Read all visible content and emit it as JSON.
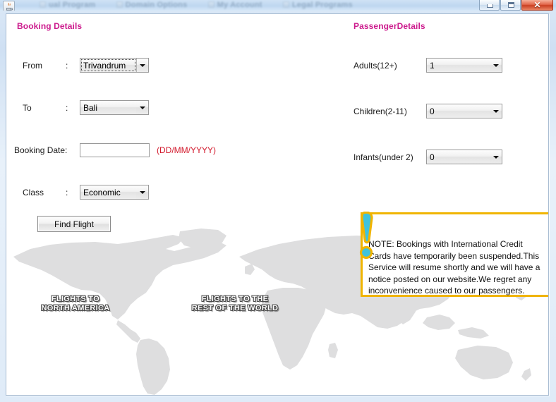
{
  "window": {
    "app_icon": "java-coffee-cup-icon",
    "ghost_tabs": [
      "ual Program",
      "Domain Options",
      "My Account",
      "Legal Programs"
    ],
    "minimize_label": "",
    "maximize_label": "",
    "close_label": "✕"
  },
  "booking": {
    "title": "Booking Details",
    "from": {
      "label": "From",
      "colon": ":",
      "value": "Trivandrum"
    },
    "to": {
      "label": "To",
      "colon": ":",
      "value": "Bali"
    },
    "booking_date": {
      "label": "Booking Date:",
      "value": "",
      "placeholder": "",
      "hint": "(DD/MM/YYYY)"
    },
    "travel_class": {
      "label": "Class",
      "colon": ":",
      "value": "Economic"
    },
    "find_flight_label": "Find Flight"
  },
  "passenger": {
    "title": "PassengerDetails",
    "adults": {
      "label": "Adults(12+)",
      "value": "1"
    },
    "children": {
      "label": "Children(2-11)",
      "value": "0"
    },
    "infants": {
      "label": "Infants(under 2)",
      "value": "0"
    }
  },
  "note": {
    "icon": "exclamation-mark-icon",
    "text": "NOTE: Bookings with International Credit Cards have temporarily been suspended.This Service will resume shortly and we will have a notice posted on our website.We regret any inconvenience caused to our passengers.",
    "border_color": "#f0b400",
    "icon_fill_color": "#3fc3dd",
    "icon_outline_color": "#f0b400"
  },
  "map": {
    "label_north_america": "FLIGHTS TO\nNORTH AMERICA",
    "label_rest_of_world": "FLIGHTS TO THE\nREST OF THE WORLD",
    "land_color": "#dededf"
  },
  "colors": {
    "section_heading": "#cc1b8d",
    "hint_red": "#d2182b",
    "panel_background": "#ffffff",
    "desktop_background": "#dce9f7"
  }
}
